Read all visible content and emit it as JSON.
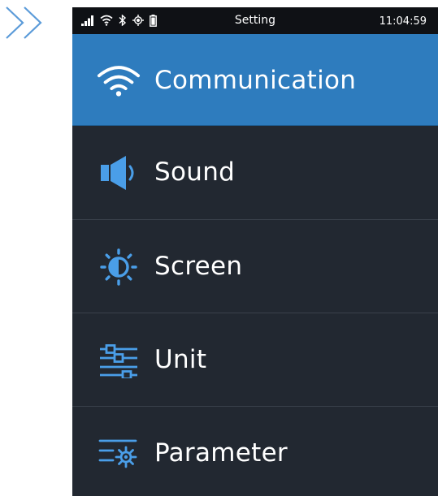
{
  "status_bar": {
    "title": "Setting",
    "time": "11:04:59",
    "icons": [
      "signal-icon",
      "wifi-icon",
      "bluetooth-icon",
      "gps-icon",
      "battery-icon"
    ]
  },
  "menu": {
    "items": [
      {
        "label": "Communication",
        "icon": "wifi-icon",
        "active": true
      },
      {
        "label": "Sound",
        "icon": "speaker-icon",
        "active": false
      },
      {
        "label": "Screen",
        "icon": "brightness-icon",
        "active": false
      },
      {
        "label": "Unit",
        "icon": "sliders-icon",
        "active": false
      },
      {
        "label": "Parameter",
        "icon": "parameter-settings-icon",
        "active": false
      }
    ]
  },
  "colors": {
    "active_background": "#2e7cbe",
    "list_background": "#222831",
    "status_background": "#0f1115",
    "icon_accent": "#4a9ee8",
    "chevron": "#5b9bd9"
  }
}
